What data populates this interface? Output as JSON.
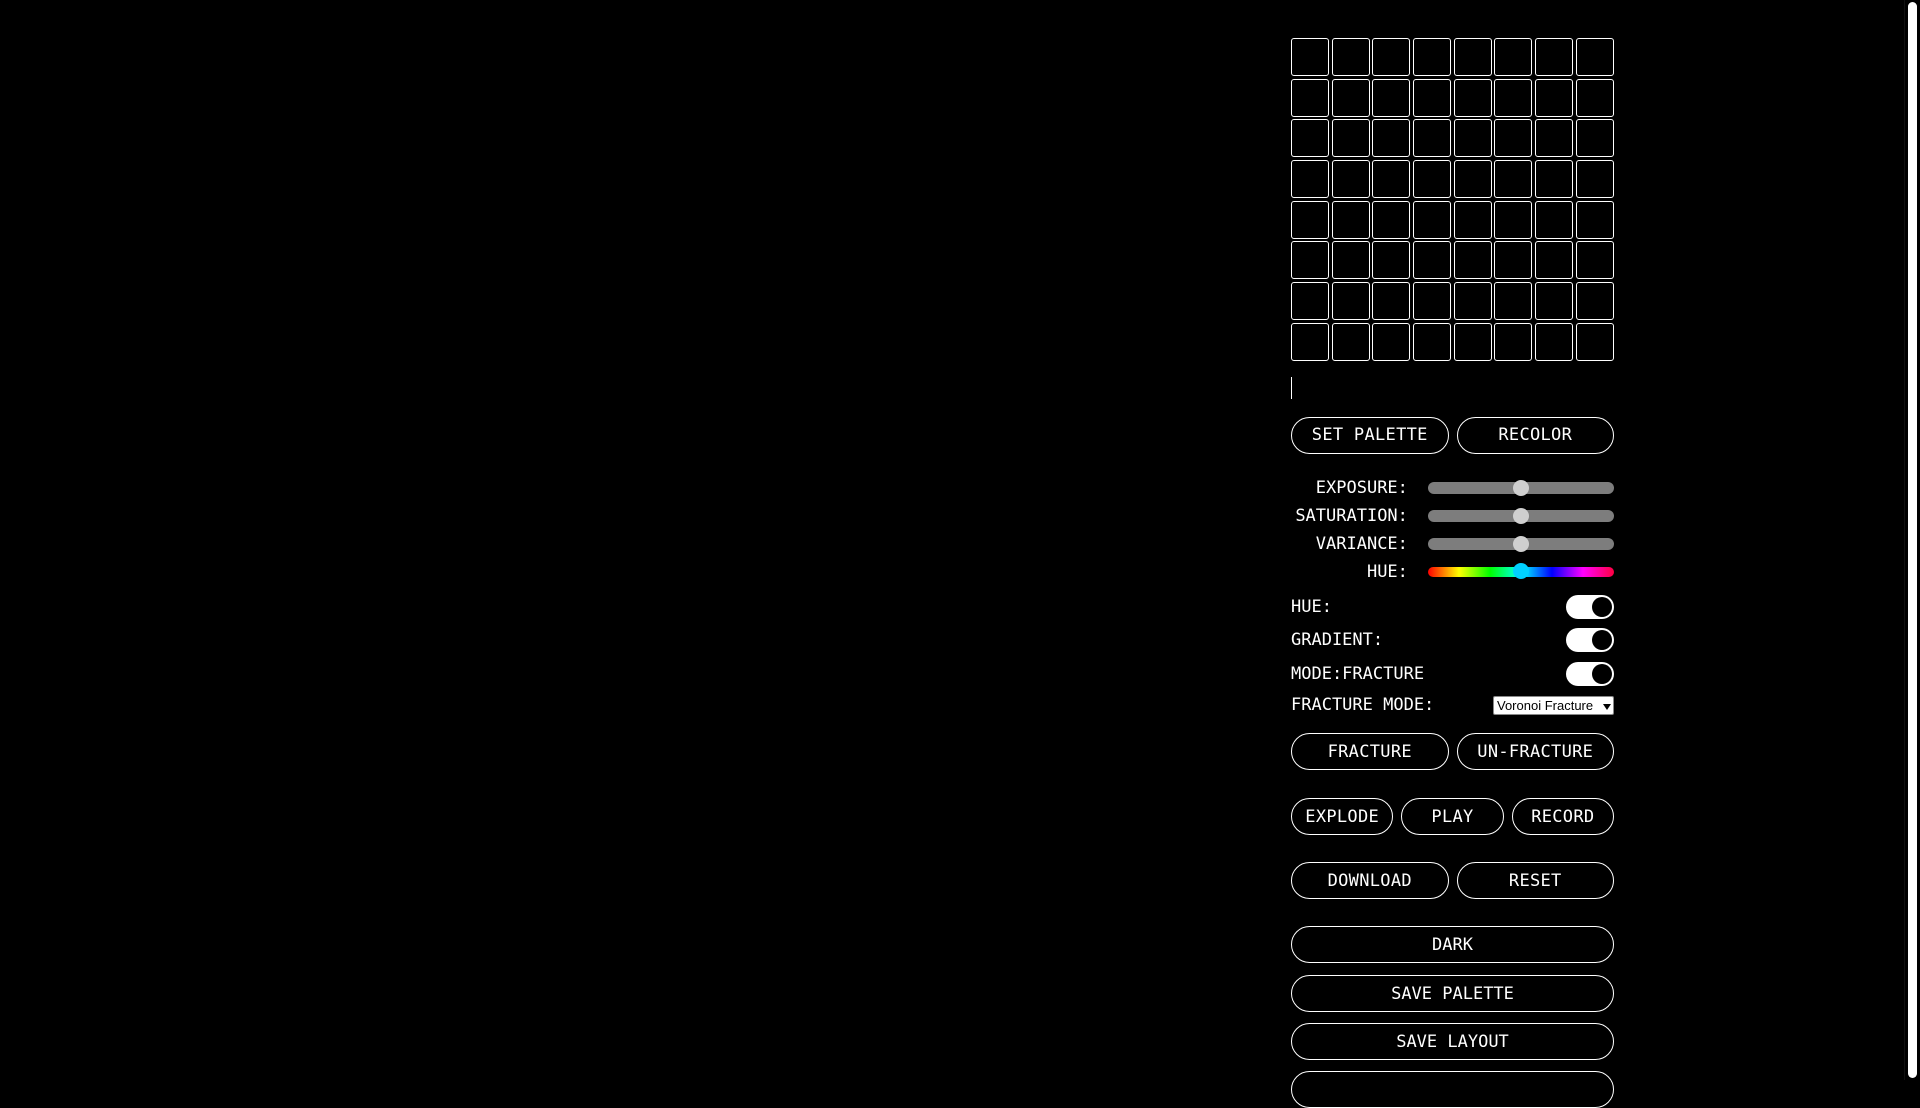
{
  "palette": {
    "rows": 8,
    "cols": 8,
    "input_value": ""
  },
  "buttons": {
    "set_palette": "SET PALETTE",
    "recolor": "RECOLOR",
    "fracture": "FRACTURE",
    "unfracture": "UN-FRACTURE",
    "explode": "EXPLODE",
    "play": "PLAY",
    "record": "RECORD",
    "download": "DOWNLOAD",
    "reset": "RESET",
    "dark": "DARK",
    "save_palette": "SAVE PALETTE",
    "save_layout": "SAVE LAYOUT"
  },
  "sliders": {
    "exposure": {
      "label": "EXPOSURE:",
      "value": 0.5
    },
    "saturation": {
      "label": "SATURATION:",
      "value": 0.5
    },
    "variance": {
      "label": "VARIANCE:",
      "value": 0.5
    },
    "hue": {
      "label": "HUE:",
      "value": 0.5
    }
  },
  "toggles": {
    "hue": {
      "label": "HUE:",
      "on": true
    },
    "gradient": {
      "label": "GRADIENT:",
      "on": true
    },
    "mode": {
      "label": "MODE:FRACTURE",
      "on": true
    }
  },
  "fracture_mode": {
    "label": "FRACTURE MODE:",
    "selected": "Voronoi Fracture"
  },
  "colors": {
    "background": "#000000",
    "foreground": "#ffffff",
    "slider_track": "#7d7d7d",
    "hue_thumb": "#00d0ff"
  }
}
